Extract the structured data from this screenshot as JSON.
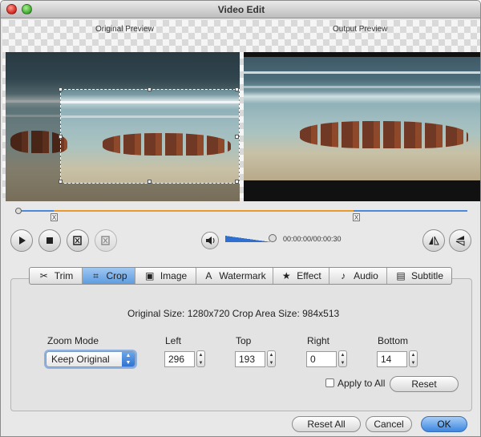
{
  "window": {
    "title": "Video Edit"
  },
  "preview": {
    "original_label": "Original Preview",
    "output_label": "Output Preview"
  },
  "playback": {
    "timecode": "00:00:00/00:00:30",
    "trim_start_marker": "X",
    "trim_end_marker": "X",
    "volume_level": 0.9
  },
  "tabs": [
    {
      "label": "Trim",
      "icon": "scissors-icon"
    },
    {
      "label": "Crop",
      "icon": "crop-icon",
      "active": true
    },
    {
      "label": "Image",
      "icon": "image-icon"
    },
    {
      "label": "Watermark",
      "icon": "watermark-icon"
    },
    {
      "label": "Effect",
      "icon": "star-icon"
    },
    {
      "label": "Audio",
      "icon": "music-note-icon"
    },
    {
      "label": "Subtitle",
      "icon": "subtitle-icon"
    }
  ],
  "crop": {
    "size_info": "Original Size: 1280x720  Crop Area Size: 984x513",
    "zoom_mode_label": "Zoom Mode",
    "zoom_mode_value": "Keep Original",
    "left_label": "Left",
    "left_value": "296",
    "top_label": "Top",
    "top_value": "193",
    "right_label": "Right",
    "right_value": "0",
    "bottom_label": "Bottom",
    "bottom_value": "14",
    "apply_all_label": "Apply to All",
    "apply_all_checked": false,
    "reset_label": "Reset"
  },
  "footer": {
    "reset_all_label": "Reset All",
    "cancel_label": "Cancel",
    "ok_label": "OK"
  },
  "colors": {
    "accent": "#5e9ce0",
    "trim_range": "#e89a2a",
    "track": "#4a8ad8"
  }
}
